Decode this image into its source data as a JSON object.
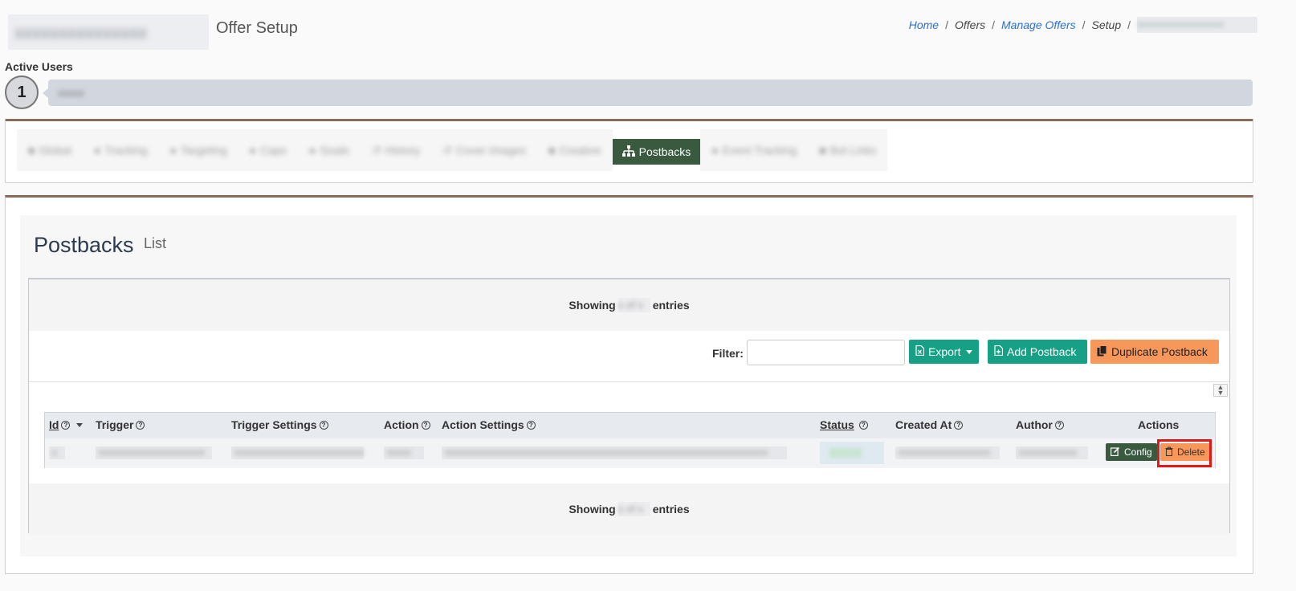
{
  "header": {
    "title": "Offer Setup",
    "breadcrumb": [
      {
        "label": "Home",
        "link": true
      },
      {
        "label": "Offers",
        "link": false
      },
      {
        "label": "Manage Offers",
        "link": true
      },
      {
        "label": "Setup",
        "link": false
      }
    ]
  },
  "active_users": {
    "label": "Active Users",
    "count": "1"
  },
  "tabs": [
    {
      "label": "Global",
      "active": false
    },
    {
      "label": "Tracking",
      "active": false
    },
    {
      "label": "Targeting",
      "active": false
    },
    {
      "label": "Caps",
      "active": false
    },
    {
      "label": "Goals",
      "active": false
    },
    {
      "label": "History",
      "active": false
    },
    {
      "label": "Cover Images",
      "active": false
    },
    {
      "label": "Creative",
      "active": false
    },
    {
      "label": "Postbacks",
      "active": true
    },
    {
      "label": "Event Tracking",
      "active": false
    },
    {
      "label": "Bot Links",
      "active": false
    }
  ],
  "section": {
    "title": "Postbacks",
    "subtitle": "List"
  },
  "table": {
    "showing_prefix": "Showing",
    "showing_suffix": "entries",
    "filter_label": "Filter:",
    "filter_value": "",
    "export_label": "Export",
    "add_label": "Add Postback",
    "duplicate_label": "Duplicate Postback",
    "columns": [
      "Id",
      "Trigger",
      "Trigger Settings",
      "Action",
      "Action Settings",
      "Status",
      "Created At",
      "Author",
      "Actions"
    ],
    "row_actions": {
      "config_label": "Config",
      "delete_label": "Delete"
    }
  },
  "colors": {
    "primary_dark": "#3a5a40",
    "teal": "#16a085",
    "orange": "#f8975a",
    "link": "#2a6fd6",
    "highlight": "#e01717"
  }
}
